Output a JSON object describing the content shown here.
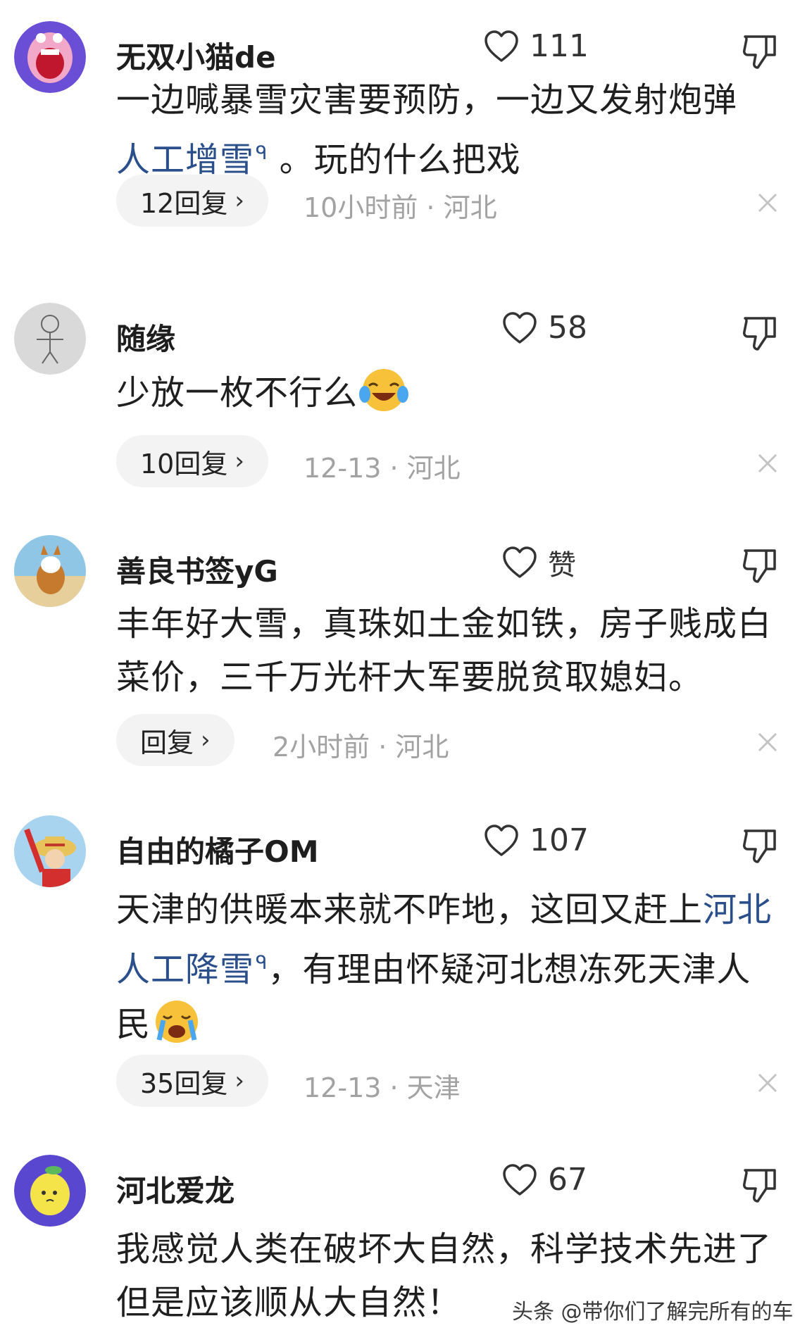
{
  "comments": [
    {
      "username": "无双小猫de",
      "likes": "111",
      "text_parts": [
        "一边喊暴雪灾害要预防，一边又发射炮弹",
        "人工增雪",
        "。玩的什么把戏"
      ],
      "replies": "12回复",
      "meta": "10小时前 · 河北"
    },
    {
      "username": "随缘",
      "likes": "58",
      "text_parts": [
        "少放一枚不行么"
      ],
      "emoji": "laughing-tears-emoji",
      "replies": "10回复",
      "meta": "12-13 · 河北"
    },
    {
      "username": "善良书签yG",
      "likes": "赞",
      "text_parts": [
        "丰年好大雪，真珠如土金如铁，房子贱成白菜价，三千万光杆大军要脱贫取媳妇。"
      ],
      "replies": "回复",
      "meta": "2小时前 · 河北"
    },
    {
      "username": "自由的橘子OM",
      "likes": "107",
      "text_parts": [
        "天津的供暖本来就不咋地，这回又赶上",
        "河北人工降雪",
        "，有理由怀疑河北想冻死天津人民"
      ],
      "emoji": "crying-emoji",
      "replies": "35回复",
      "meta": "12-13 · 天津"
    },
    {
      "username": "河北爱龙",
      "likes": "67",
      "text_parts": [
        "我感觉人类在破坏大自然，科学技术先进了但是应该顺从大自然！"
      ]
    }
  ],
  "watermark": "头条 @带你们了解完所有的车",
  "icons": {
    "like": "heart-outline-icon",
    "dislike": "thumbs-down-icon",
    "close": "close-icon",
    "chevron": "chevron-right-icon",
    "search": "search-icon"
  },
  "colors": {
    "link": "#2a4f8a",
    "meta": "#a2a2a2",
    "pill_bg": "#f3f3f3"
  }
}
